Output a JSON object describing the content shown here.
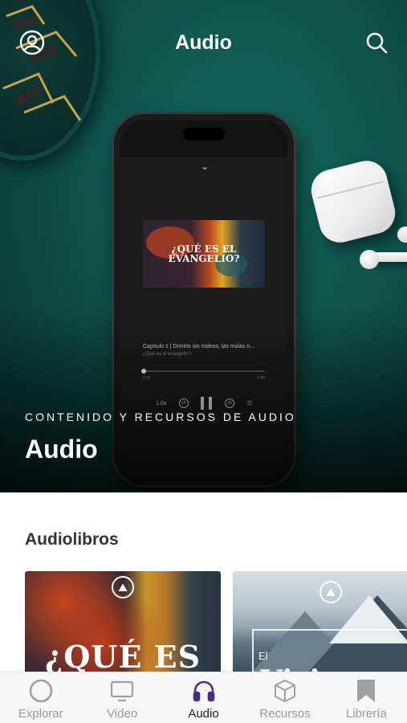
{
  "header": {
    "title": "Audio",
    "profile_icon": "user-circle-icon",
    "search_icon": "search-icon"
  },
  "hero": {
    "kicker": "CONTENIDO Y RECURSOS DE AUDIO",
    "title": "Audio",
    "player": {
      "book_title_line1": "¿QUÉ ES EL",
      "book_title_line2": "EVANGELIO?",
      "track_title": "Capítulo 1 | Dímelo sin rodeos, las malas n...",
      "track_subtitle": "¿Qué es el evangelio?",
      "time_current": "0:01",
      "time_remaining": "-7:42",
      "speed": "1.0x",
      "skip_back": "15",
      "skip_forward": "30",
      "progress": 0.02
    }
  },
  "section": {
    "title": "Audiolibros"
  },
  "audiobooks": [
    {
      "title": "¿QUÉ ES EL"
    },
    {
      "small_title": "El",
      "title": "Visio"
    }
  ],
  "tabbar": {
    "active": "Audio",
    "tabs": [
      {
        "label": "Explorar",
        "icon": "compass-circle-icon"
      },
      {
        "label": "Video",
        "icon": "tv-icon"
      },
      {
        "label": "Audio",
        "icon": "headphones-icon"
      },
      {
        "label": "Recursos",
        "icon": "box-icon"
      },
      {
        "label": "Librería",
        "icon": "bookmark-icon"
      }
    ]
  },
  "colors": {
    "hero_green": "#0f554e",
    "active_tab_icon": "#4a2e84",
    "inactive_tab": "#9a9a9a"
  }
}
